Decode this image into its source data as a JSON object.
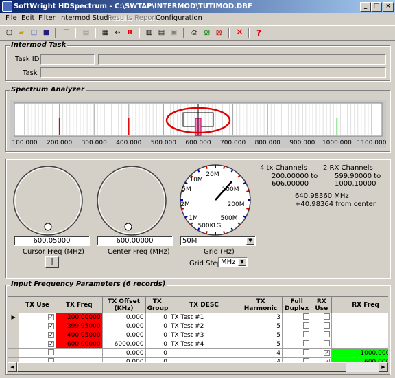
{
  "window": {
    "title": "SoftWright HDSpectrum - C:\\SWTAP\\INTERMOD\\TUTIMOD.DBF"
  },
  "caption_buttons": [
    "_",
    "□",
    "×"
  ],
  "menu": [
    "File",
    "Edit",
    "Filter",
    "Intermod Study",
    "Results Report",
    "Configuration"
  ],
  "intermod_task": {
    "title": "Intermod Task",
    "task_id_label": "Task ID:",
    "task_label": "Task",
    "task_id_value": "",
    "task_id_desc": "",
    "task_value": ""
  },
  "spectrum": {
    "title": "Spectrum Analyzer",
    "ticks": [
      "100.000",
      "200.000",
      "300.000",
      "400.000",
      "500.000",
      "600.000",
      "700.000",
      "800.000",
      "900.000",
      "1000.000",
      "1100.000"
    ],
    "range": [
      100,
      1100
    ],
    "red_markers": [
      200,
      400
    ],
    "green_markers": [
      1000
    ],
    "zoom_marker": 600,
    "colors": {
      "red": "#e00000",
      "green": "#00c000",
      "highlight": "#e00000"
    }
  },
  "dials": {
    "cursor_freq": {
      "value": "600.05000",
      "label": "Cursor Freq (MHz)",
      "button": "|"
    },
    "center_freq": {
      "value": "600.00000",
      "label": "Center Freq (MHz)"
    },
    "grid": {
      "value": "50M",
      "label": "Grid (Hz)",
      "step_label": "Grid Step",
      "step_value": "MHz",
      "dial_labels": [
        "20M",
        "10M",
        "100M",
        "5M",
        "200M",
        "2M",
        "500M",
        "1M",
        "500K",
        "1G"
      ]
    }
  },
  "info": {
    "tx_title": "4 tx Channels",
    "tx_range_1": "200.00000 to",
    "tx_range_2": "606.00000",
    "rx_title": "2 RX Channels",
    "rx_range_1": "599.90000 to",
    "rx_range_2": "1000.10000",
    "center_1": "640.98360 MHz",
    "center_2": "+40.98364 from center"
  },
  "table": {
    "title": "Input Frequency Parameters (6 records)",
    "headers": [
      "TX Use",
      "TX Freq",
      "TX Offset (KHz)",
      "TX Group",
      "TX DESC",
      "TX Harmonic",
      "Full Duplex",
      "RX Use",
      "RX Freq",
      "RX"
    ],
    "rows": [
      {
        "current": true,
        "tx_use": true,
        "tx_freq": "200.00000",
        "tx_offset": "0.000",
        "tx_group": "0",
        "tx_desc": "TX Test #1",
        "tx_harmonic": "3",
        "full_duplex": false,
        "rx_use": false,
        "rx_freq": "",
        "rx": ""
      },
      {
        "current": false,
        "tx_use": true,
        "tx_freq": "399.95000",
        "tx_offset": "0.000",
        "tx_group": "0",
        "tx_desc": "TX Test #2",
        "tx_harmonic": "5",
        "full_duplex": false,
        "rx_use": false,
        "rx_freq": "",
        "rx": ""
      },
      {
        "current": false,
        "tx_use": true,
        "tx_freq": "400.05000",
        "tx_offset": "0.000",
        "tx_group": "0",
        "tx_desc": "TX Test #3",
        "tx_harmonic": "5",
        "full_duplex": false,
        "rx_use": false,
        "rx_freq": "",
        "rx": ""
      },
      {
        "current": false,
        "tx_use": true,
        "tx_freq": "600.00000",
        "tx_offset": "6000.000",
        "tx_group": "0",
        "tx_desc": "TX Test #4",
        "tx_harmonic": "5",
        "full_duplex": false,
        "rx_use": false,
        "rx_freq": "",
        "rx": ""
      },
      {
        "current": false,
        "tx_use": false,
        "tx_freq": "",
        "tx_offset": "0.000",
        "tx_group": "0",
        "tx_desc": "",
        "tx_harmonic": "4",
        "full_duplex": false,
        "rx_use": true,
        "rx_freq": "1000.00000",
        "rx": "RX Test"
      },
      {
        "current": false,
        "tx_use": false,
        "tx_freq": "",
        "tx_offset": "0.000",
        "tx_group": "0",
        "tx_desc": "",
        "tx_harmonic": "4",
        "full_duplex": false,
        "rx_use": true,
        "rx_freq": "600.00000",
        "rx": "RX Test"
      }
    ],
    "tx_freq_color": "#ff0000",
    "rx_freq_color": "#00ff00"
  }
}
